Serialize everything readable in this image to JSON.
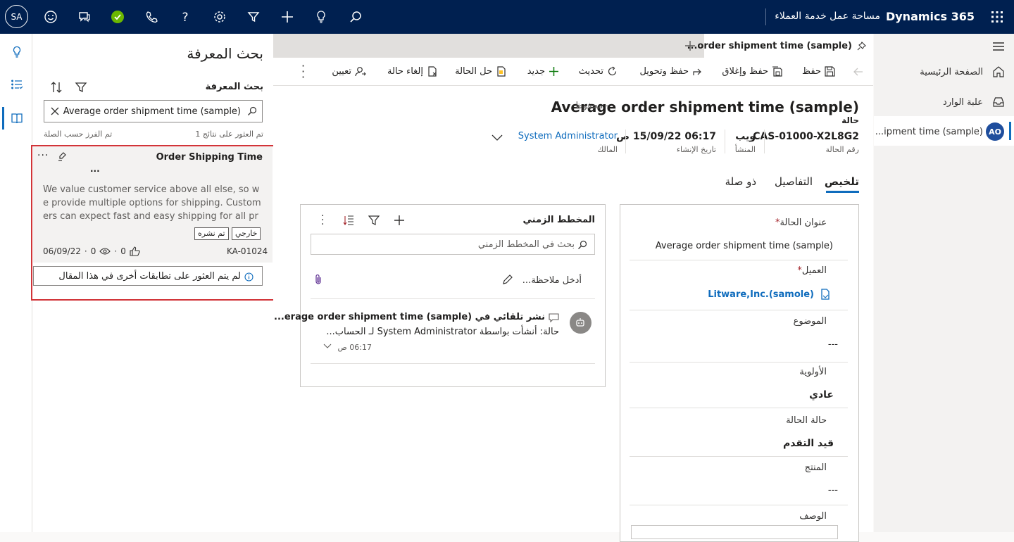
{
  "topbar": {
    "brand": "Dynamics 365",
    "app_name": "مساحة عمل خدمة العملاء",
    "avatar_initials": "SA",
    "presence_color": "#6bb700"
  },
  "sitemap": {
    "home": "الصفحة الرئيسية",
    "inbox": "علبة الوارد",
    "session_avatar": "AO",
    "session_label": "ipment time (sample)..."
  },
  "session_tab": {
    "label": "order shipment time (sample)..."
  },
  "commands": {
    "save": "حفظ",
    "save_close": "حفظ وإغلاق",
    "save_route": "حفظ وتحويل",
    "refresh": "تحديث",
    "new": "جديد",
    "resolve": "حل الحالة",
    "cancel": "إلغاء حالة",
    "assign": "تعيين"
  },
  "record": {
    "title": "Average order shipment time (sample)",
    "saved_status": "- محفوظ",
    "entity": "حالة",
    "case_number": "CAS-01000-X2L8G2",
    "case_number_label": "رقم الحالة",
    "origin": "ويب",
    "origin_label": "المنشأ",
    "created_on": "06:17 15/09/22 ص",
    "created_on_label": "تاريخ الإنشاء",
    "owner": "System Administrator",
    "owner_label": "المالك"
  },
  "tabs": {
    "summary": "تلخيص",
    "details": "التفاصيل",
    "related": "ذو صلة"
  },
  "form": {
    "case_title_label": "عنوان الحالة",
    "case_title_value": "Average order shipment time (sample)",
    "customer_label": "العميل",
    "customer_value": "Litware,Inc.(samole)",
    "subject_label": "الموضوع",
    "subject_value": "---",
    "priority_label": "الأولوية",
    "priority_value": "عادي",
    "status_label": "حالة الحالة",
    "status_value": "قيد التقدم",
    "product_label": "المنتج",
    "product_value": "---",
    "description_label": "الوصف",
    "required_marker": "*"
  },
  "timeline": {
    "title": "المخطط الزمني",
    "search_placeholder": "بحث في المخطط الزمني",
    "note_placeholder": "أدخل ملاحظة...",
    "item_title": "نشر تلقائي في erage order shipment time (sample)...",
    "item_body": "حالة: أنشأت بواسطة System Administrator لـ الحساب...",
    "item_time": "06:17 ص"
  },
  "knowledge": {
    "panel_title": "بحث المعرفة",
    "section_title": "بحث المعرفة",
    "search_value": "Average order shipment time (sample)",
    "results_count": "تم العثور على نتائج 1",
    "sort_label": "تم الفرز حسب الصلة",
    "article": {
      "title": "Order Shipping Time",
      "ellipsis": "...",
      "snippet": "We value customer service above all else, so we provide multiple options for shipping. Customers can expect fast and easy shipping for all products. W...",
      "badge_external": "خارجي",
      "badge_published": "تم نشره",
      "number": "KA-01024",
      "likes": "0",
      "views": "0",
      "date": "06/09/22",
      "dot": "·",
      "no_apps": "لم يتم العثور على تطابقات أخرى في هذا المقال"
    },
    "highlight_color": "#d13438"
  }
}
